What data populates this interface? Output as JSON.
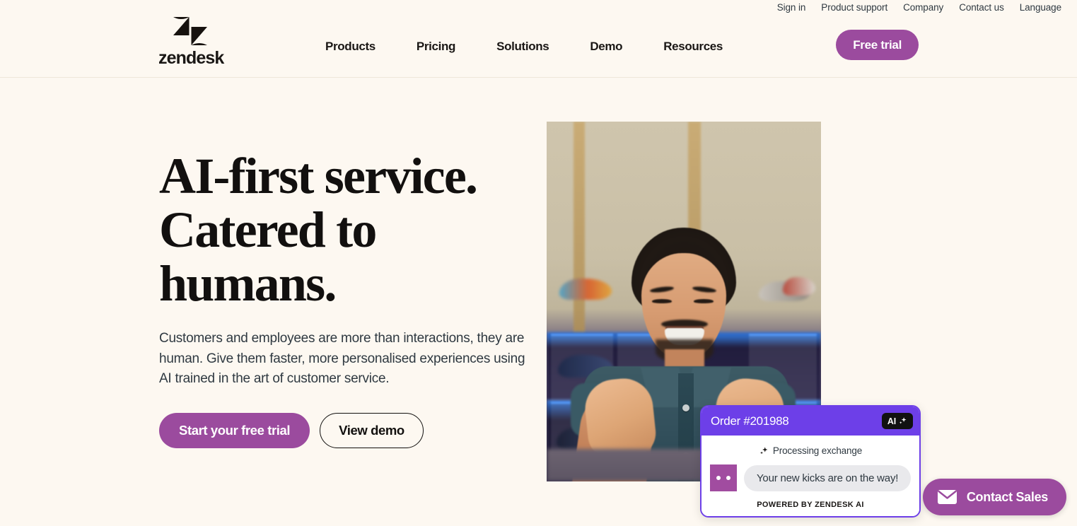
{
  "utility_nav": {
    "items": [
      {
        "label": "Sign in",
        "name": "utility-link-sign-in"
      },
      {
        "label": "Product support",
        "name": "utility-link-product-support"
      },
      {
        "label": "Company",
        "name": "utility-link-company"
      },
      {
        "label": "Contact us",
        "name": "utility-link-contact-us"
      },
      {
        "label": "Language",
        "name": "utility-link-language"
      }
    ]
  },
  "brand": {
    "wordmark": "zendesk",
    "logo_icon": "zendesk-z-logo"
  },
  "main_nav": {
    "items": [
      {
        "label": "Products"
      },
      {
        "label": "Pricing"
      },
      {
        "label": "Solutions"
      },
      {
        "label": "Demo"
      },
      {
        "label": "Resources"
      }
    ]
  },
  "header": {
    "free_trial_label": "Free trial"
  },
  "hero": {
    "title": "AI-first service.\nCatered to\nhumans.",
    "subtitle": "Customers and employees are more than interactions, they are human. Give them faster, more personalised experiences using AI trained in the art of customer service.",
    "primary_cta": "Start your free trial",
    "secondary_cta": "View demo",
    "image_alt": "Smiling man pointing at camera in a sneaker store"
  },
  "chat_card": {
    "order_title": "Order #201988",
    "ai_badge_label": "AI",
    "ai_badge_icon": "sparkle-icon",
    "status_text": "Processing exchange",
    "status_icon": "sparkle-icon",
    "avatar_icon": "bot-avatar",
    "message": "Your new kicks are on the way!",
    "powered_by": "POWERED BY ZENDESK AI"
  },
  "contact_sales": {
    "label": "Contact Sales",
    "icon": "envelope-icon"
  },
  "colors": {
    "page_background": "#fdf8f1",
    "brand_purple": "#9b4b9e",
    "ai_violet": "#6d3fe8",
    "avatar_purple": "#a14ca0",
    "text_dark": "#12100f",
    "bubble_gray": "#e9e9ec",
    "header_divider": "#efe7da"
  }
}
